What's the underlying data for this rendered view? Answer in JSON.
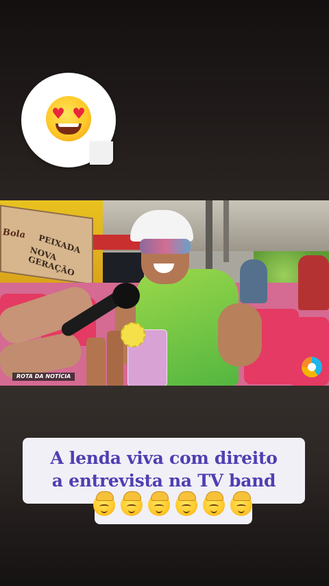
{
  "reaction": {
    "emoji_icon": "heart-eyes-emoji-icon"
  },
  "video": {
    "overlay_label": "ROTA DA NOTÍCIA",
    "signboard": {
      "brand": "Bola",
      "line1": "PEIXADA",
      "line2": "NOVA GERAÇÃO"
    },
    "channel_logo_icon": "channel-logo-icon"
  },
  "caption": {
    "line1": "A lenda viva com direito",
    "line2": "a entrevista na TV band",
    "emoji_icon": "heat-face-emoji-icon",
    "emoji_count": 6
  },
  "colors": {
    "caption_text": "#4f3fb2",
    "caption_bg": "#f1f0f6",
    "background_top": "#141010",
    "background_mid": "#3a3431"
  }
}
